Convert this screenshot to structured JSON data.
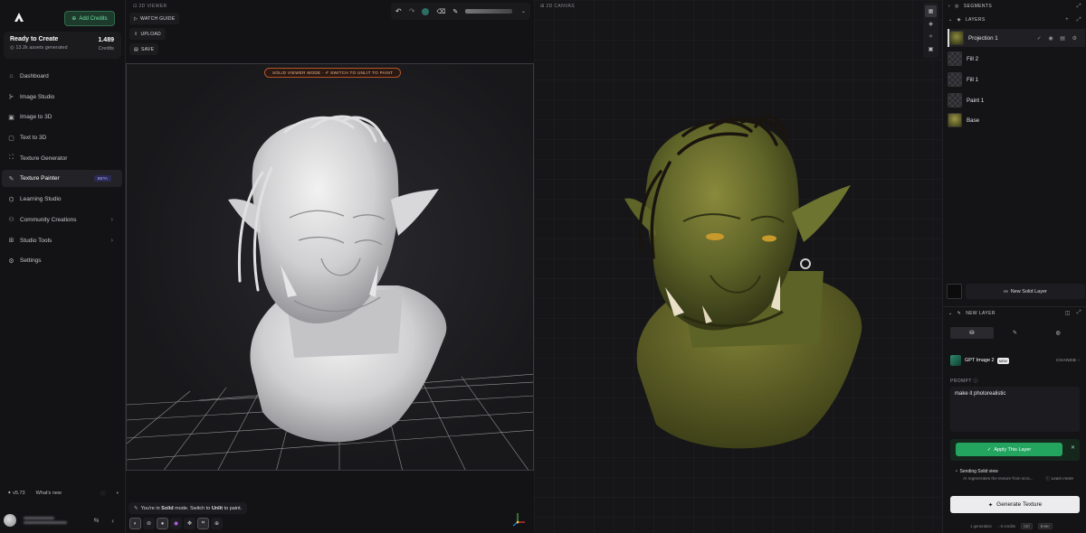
{
  "sidebar": {
    "add_credits": "Add Credits",
    "status": {
      "title": "Ready to Create",
      "assets": "13.2k assets generated",
      "credits_value": "1.489",
      "credits_label": "Credits"
    },
    "nav": [
      {
        "label": "Dashboard",
        "icon": "home-icon"
      },
      {
        "label": "Image Studio",
        "icon": "image-studio-icon"
      },
      {
        "label": "Image to 3D",
        "icon": "image-to-3d-icon"
      },
      {
        "label": "Text to 3D",
        "icon": "text-to-3d-icon"
      },
      {
        "label": "Texture Generator",
        "icon": "texture-generator-icon"
      },
      {
        "label": "Texture Painter",
        "icon": "brush-icon",
        "badge": "BETA",
        "active": true
      },
      {
        "label": "Learning Studio",
        "icon": "graduation-icon"
      },
      {
        "label": "Community Creations",
        "icon": "community-icon"
      },
      {
        "label": "Studio Tools",
        "icon": "tools-icon"
      },
      {
        "label": "Settings",
        "icon": "gear-icon"
      }
    ],
    "version": "v5.73",
    "whats_new": "What's new"
  },
  "viewer3d": {
    "label": "3D VIEWER",
    "watch_guide": "WATCH GUIDE",
    "upload": "UPLOAD",
    "save": "SAVE",
    "mode_banner": "SOLID VIEWER MODE · ✐ SWITCH TO UNLIT TO PAINT",
    "bottom_message_pre": "You're in ",
    "bottom_message_mode": "Solid",
    "bottom_message_mid": " mode. Switch to ",
    "bottom_message_target": "Unlit",
    "bottom_message_post": " to paint."
  },
  "canvas2d": {
    "label": "2D CANVAS"
  },
  "panel": {
    "segments": "SEGMENTS",
    "layers": "LAYERS",
    "layer_list": [
      "Projection 1",
      "Fill 2",
      "Fill 1",
      "Paint 1",
      "Base"
    ],
    "new_solid_layer": "New Solid Layer",
    "new_layer": "NEW LAYER",
    "model_name": "GPT Image 2",
    "model_badge": "NEW",
    "change": "CHANGE",
    "prompt_label": "PROMPT",
    "prompt_value": "make it photorealistic",
    "apply": "Apply This Layer",
    "sending_title": "Sending Solid view",
    "sending_sub": "AI regenerates the texture from scra...",
    "learn_more": "Learn more",
    "generate": "Generate Texture",
    "foot_generation": "1 generation",
    "foot_credits": "5 credits",
    "foot_key1": "Ctrl",
    "foot_key2": "Enter"
  },
  "colors": {
    "accent_green": "#23a55f",
    "banner_orange": "#b4552a"
  }
}
